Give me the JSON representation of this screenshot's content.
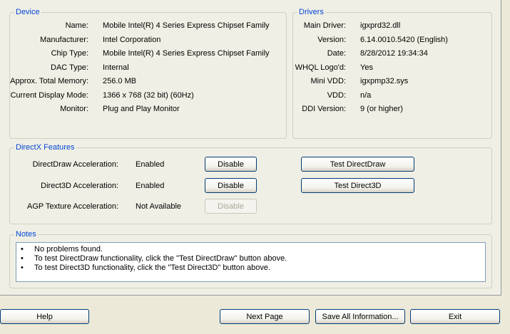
{
  "device": {
    "title": "Device",
    "rows": [
      {
        "label": "Name:",
        "value": "Mobile Intel(R) 4 Series Express Chipset Family"
      },
      {
        "label": "Manufacturer:",
        "value": "Intel Corporation"
      },
      {
        "label": "Chip Type:",
        "value": "Mobile Intel(R) 4 Series Express Chipset Family"
      },
      {
        "label": "DAC Type:",
        "value": "Internal"
      },
      {
        "label": "Approx. Total Memory:",
        "value": "256.0 MB"
      },
      {
        "label": "Current Display Mode:",
        "value": "1366 x 768 (32 bit) (60Hz)"
      },
      {
        "label": "Monitor:",
        "value": "Plug and Play Monitor"
      }
    ]
  },
  "drivers": {
    "title": "Drivers",
    "rows": [
      {
        "label": "Main Driver:",
        "value": "igxprd32.dll"
      },
      {
        "label": "Version:",
        "value": "6.14.0010.5420 (English)"
      },
      {
        "label": "Date:",
        "value": "8/28/2012 19:34:34"
      },
      {
        "label": "WHQL Logo'd:",
        "value": "Yes"
      },
      {
        "label": "Mini VDD:",
        "value": "igxpmp32.sys"
      },
      {
        "label": "VDD:",
        "value": "n/a"
      },
      {
        "label": "DDI Version:",
        "value": "9 (or higher)"
      }
    ]
  },
  "directx": {
    "title": "DirectX Features",
    "rows": [
      {
        "label": "DirectDraw Acceleration:",
        "value": "Enabled",
        "button": "Disable",
        "test_button": "Test DirectDraw"
      },
      {
        "label": "Direct3D Acceleration:",
        "value": "Enabled",
        "button": "Disable",
        "test_button": "Test Direct3D"
      },
      {
        "label": "AGP Texture Acceleration:",
        "value": "Not Available",
        "button": "Disable"
      }
    ]
  },
  "notes": {
    "title": "Notes",
    "bullet": "•",
    "lines": [
      "No problems found.",
      "To test DirectDraw functionality, click the \"Test DirectDraw\" button above.",
      "To test Direct3D functionality, click the \"Test Direct3D\" button above."
    ]
  },
  "footer": {
    "help": "Help",
    "next_page": "Next Page",
    "save_all": "Save All Information...",
    "exit": "Exit"
  }
}
